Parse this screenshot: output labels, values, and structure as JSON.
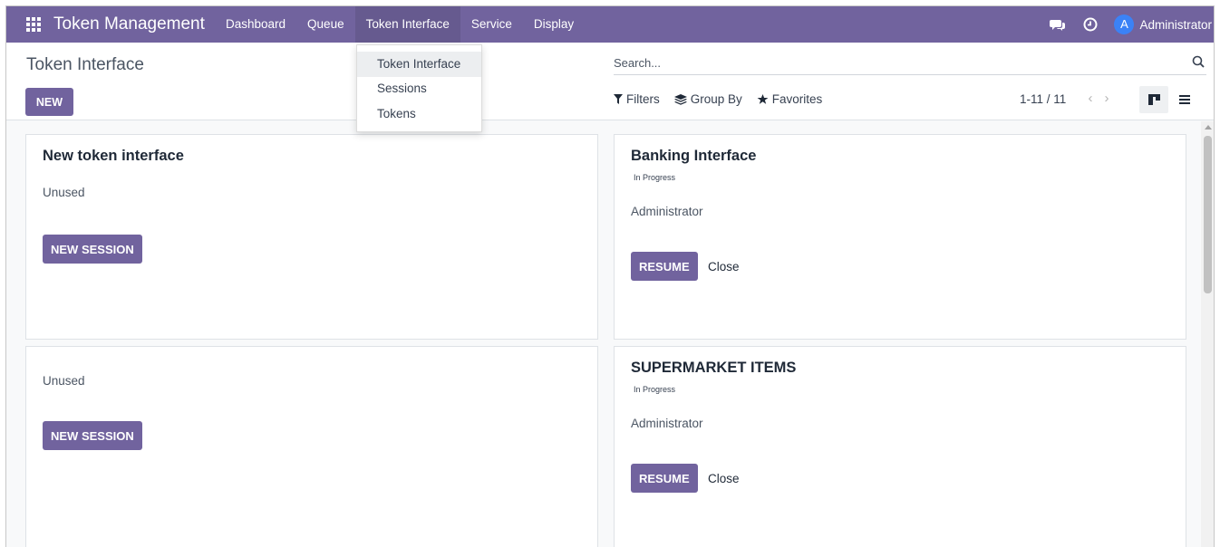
{
  "app": {
    "name": "Token Management"
  },
  "nav": {
    "menu": [
      "Dashboard",
      "Queue",
      "Token Interface",
      "Service",
      "Display"
    ],
    "user": {
      "initial": "A",
      "name": "Administrator"
    }
  },
  "dropdown": {
    "items": [
      "Token Interface",
      "Sessions",
      "Tokens"
    ]
  },
  "control": {
    "breadcrumb": "Token Interface",
    "new_label": "NEW",
    "search_placeholder": "Search...",
    "filters_label": "Filters",
    "group_by_label": "Group By",
    "favorites_label": "Favorites",
    "pager": "1-11 / 11"
  },
  "cards": [
    {
      "title": "New token interface",
      "status": "Unused",
      "button": "NEW SESSION"
    },
    {
      "title": "Banking Interface",
      "badge": "In Progress",
      "user": "Administrator",
      "button": "RESUME",
      "link": "Close"
    },
    {
      "title": "",
      "status": "Unused",
      "button": "NEW SESSION"
    },
    {
      "title": "SUPERMARKET ITEMS",
      "badge": "In Progress",
      "user": "Administrator",
      "button": "RESUME",
      "link": "Close"
    }
  ],
  "colors": {
    "primary": "#71639e",
    "avatar": "#3b82f6"
  },
  "icons": [
    "apps-grid-icon",
    "chat-icon",
    "clock-icon",
    "search-icon",
    "filter-icon",
    "layers-icon",
    "star-icon",
    "chevron-left-icon",
    "chevron-right-icon",
    "kanban-view-icon",
    "list-view-icon"
  ]
}
